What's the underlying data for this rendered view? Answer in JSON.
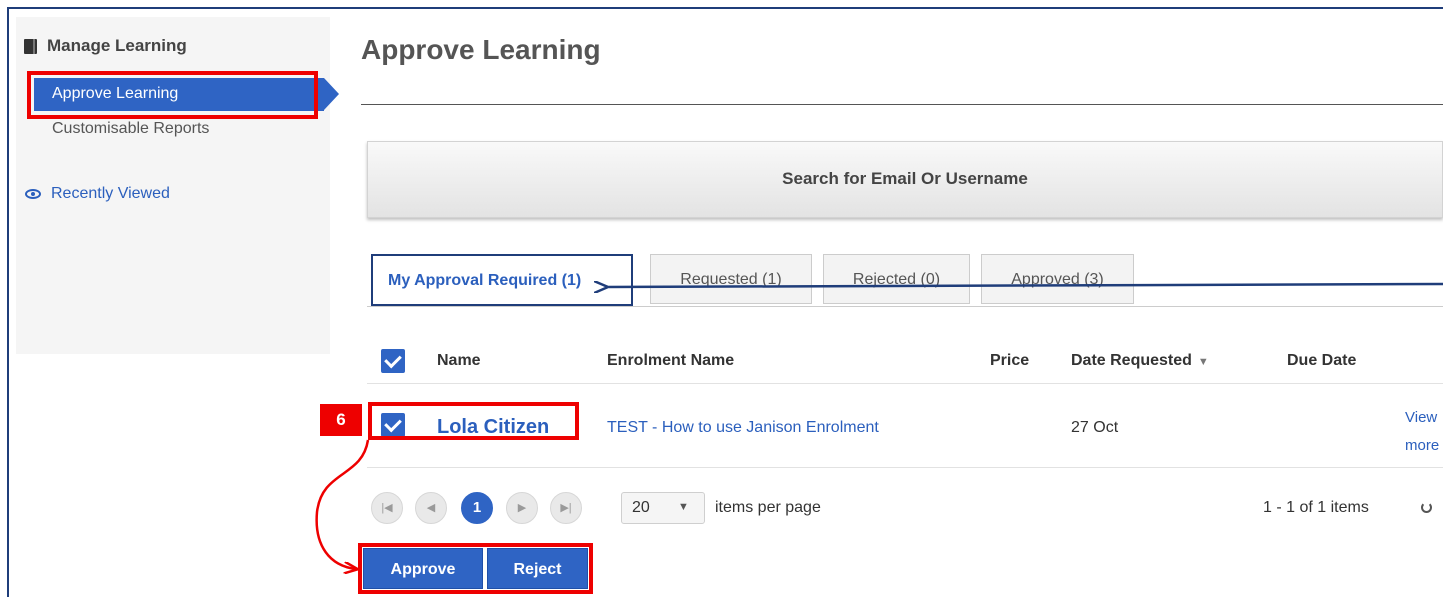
{
  "sidebar": {
    "section_title": "Manage Learning",
    "items": [
      {
        "label": "Approve Learning"
      },
      {
        "label": "Customisable Reports"
      }
    ],
    "recently_viewed": "Recently Viewed"
  },
  "page": {
    "title": "Approve Learning",
    "search_label": "Search for Email Or Username"
  },
  "tabs": [
    {
      "label": "My Approval Required (1)"
    },
    {
      "label": "Requested (1)"
    },
    {
      "label": "Rejected (0)"
    },
    {
      "label": "Approved (3)"
    }
  ],
  "table": {
    "headers": [
      "Name",
      "Enrolment Name",
      "Price",
      "Date Requested",
      "Due Date"
    ],
    "rows": [
      {
        "name": "Lola Citizen",
        "enrolment": "TEST - How to use Janison Enrolment",
        "price": "",
        "date_requested": "27 Oct",
        "due_date": "",
        "link_line1": "View",
        "link_line2": "more"
      }
    ]
  },
  "pager": {
    "current_page": "1",
    "per_page": "20",
    "per_page_label": "items per page",
    "items_info": "1 - 1 of 1 items"
  },
  "actions": {
    "approve": "Approve",
    "reject": "Reject"
  },
  "annotation": {
    "step": "6"
  },
  "colors": {
    "accent": "#2f64c4",
    "link": "#2b5fbd",
    "annotation_red": "#ee0000",
    "annotation_blue": "#1f3d7a"
  }
}
